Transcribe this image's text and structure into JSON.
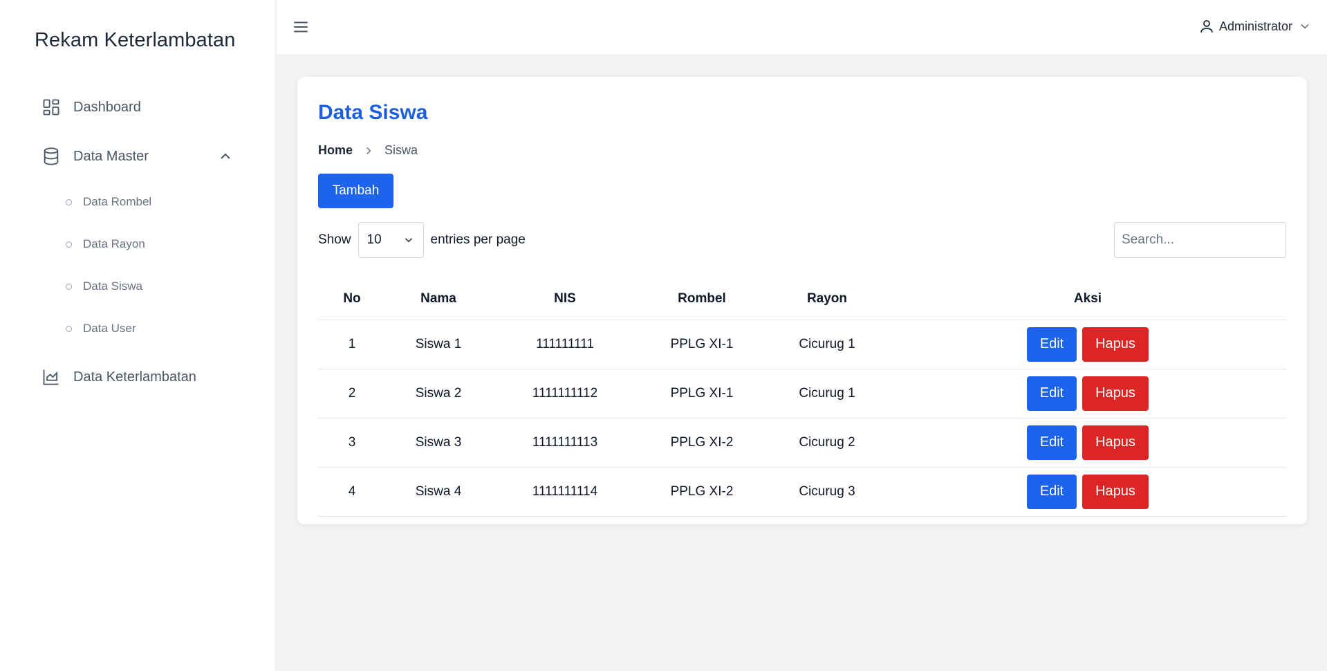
{
  "app": {
    "brand": "Rekam Keterlambatan"
  },
  "sidebar": {
    "items": [
      {
        "label": "Dashboard",
        "icon": "dashboard-grid-icon"
      },
      {
        "label": "Data Master",
        "icon": "database-icon",
        "expanded": true,
        "children": [
          "Data Rombel",
          "Data Rayon",
          "Data Siswa",
          "Data User"
        ]
      },
      {
        "label": "Data Keterlambatan",
        "icon": "chart-area-icon"
      }
    ]
  },
  "topbar": {
    "user_label": "Administrator"
  },
  "page": {
    "title": "Data Siswa",
    "breadcrumb": {
      "home": "Home",
      "current": "Siswa"
    },
    "add_button": "Tambah",
    "show_label": "Show",
    "entries_value": "10",
    "entries_label": "entries per page",
    "search_placeholder": "Search..."
  },
  "table": {
    "headers": [
      "No",
      "Nama",
      "NIS",
      "Rombel",
      "Rayon",
      "Aksi"
    ],
    "rows": [
      {
        "no": "1",
        "nama": "Siswa 1",
        "nis": "111111111",
        "rombel": "PPLG XI-1",
        "rayon": "Cicurug 1"
      },
      {
        "no": "2",
        "nama": "Siswa 2",
        "nis": "1111111112",
        "rombel": "PPLG XI-1",
        "rayon": "Cicurug 1"
      },
      {
        "no": "3",
        "nama": "Siswa 3",
        "nis": "1111111113",
        "rombel": "PPLG XI-2",
        "rayon": "Cicurug 2"
      },
      {
        "no": "4",
        "nama": "Siswa 4",
        "nis": "1111111114",
        "rombel": "PPLG XI-2",
        "rayon": "Cicurug 3"
      }
    ],
    "edit_label": "Edit",
    "delete_label": "Hapus"
  },
  "colors": {
    "primary": "#1d63ed",
    "danger": "#dc2626",
    "title": "#1d5fdc"
  }
}
